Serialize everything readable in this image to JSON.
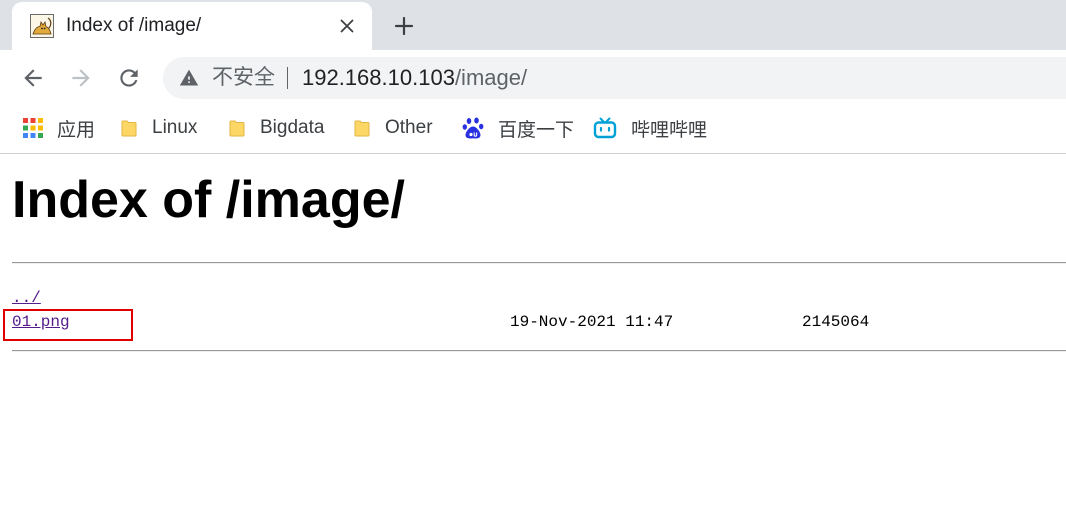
{
  "browser": {
    "tab": {
      "title": "Index of /image/",
      "favicon": "tomcat-icon",
      "close_icon": "close-icon"
    },
    "new_tab_icon": "plus-icon",
    "toolbar": {
      "back_icon": "arrow-left-icon",
      "forward_icon": "arrow-right-icon",
      "reload_icon": "reload-icon"
    },
    "omnibox": {
      "security_icon": "warning-triangle-icon",
      "security_label": "不安全",
      "url_host": "192.168.10.103",
      "url_path": "/image/"
    },
    "bookmarks": [
      {
        "label": "应用",
        "icon": "apps-grid-icon"
      },
      {
        "label": "Linux",
        "icon": "folder-icon"
      },
      {
        "label": "Bigdata",
        "icon": "folder-icon"
      },
      {
        "label": "Other",
        "icon": "folder-icon"
      },
      {
        "label": "百度一下",
        "icon": "baidu-icon"
      },
      {
        "label": "哔哩哔哩",
        "icon": "bilibili-icon"
      }
    ]
  },
  "page": {
    "heading": "Index of /image/",
    "parent_link": "../",
    "entries": [
      {
        "name": "01.png",
        "modified": "19-Nov-2021 11:47",
        "size": "2145064"
      }
    ]
  },
  "colors": {
    "tab_strip": "#dee1e6",
    "omnibox": "#f1f3f4",
    "icon": "#5f6368",
    "icon_disabled": "#bdc1c6",
    "text": "#202124",
    "link": "#551a8b",
    "highlight": "#e00000",
    "baidu": "#2932e1",
    "bilibili": "#00a1d6",
    "folder": "#fcd766"
  }
}
